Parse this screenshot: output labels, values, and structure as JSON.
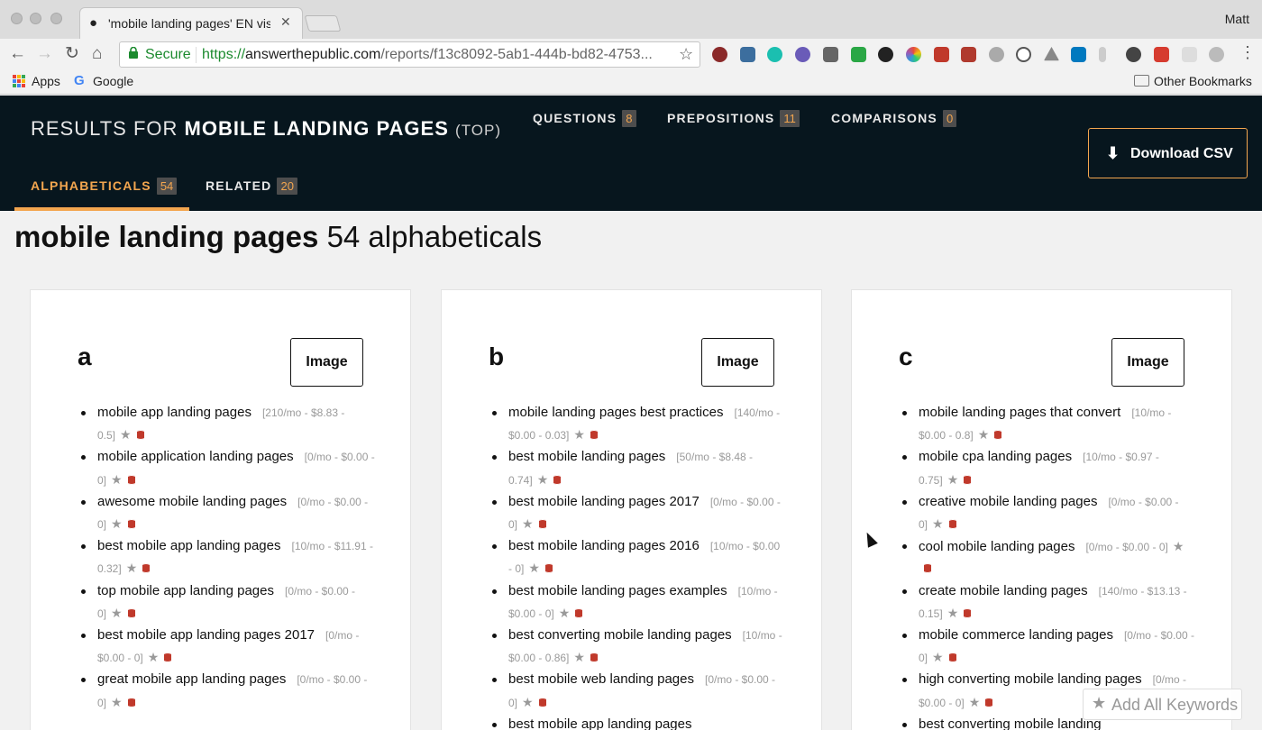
{
  "browser": {
    "tab_title": "'mobile landing pages' EN visu",
    "user_name": "Matt",
    "secure_label": "Secure",
    "url_scheme": "https://",
    "url_host": "answerthepublic.com",
    "url_path": "/reports/f13c8092-5ab1-444b-bd82-4753...",
    "bookmarks": {
      "apps": "Apps",
      "google": "Google",
      "other": "Other Bookmarks"
    }
  },
  "header": {
    "title_prefix": "RESULTS FOR",
    "title_keyword": "MOBILE LANDING PAGES",
    "title_suffix": "(TOP)",
    "tabs": [
      {
        "label": "QUESTIONS",
        "count": "8"
      },
      {
        "label": "PREPOSITIONS",
        "count": "11"
      },
      {
        "label": "COMPARISONS",
        "count": "0"
      },
      {
        "label": "ALPHABETICALS",
        "count": "54"
      },
      {
        "label": "RELATED",
        "count": "20"
      }
    ],
    "download_label": "Download CSV"
  },
  "main": {
    "heading_keyword": "mobile landing pages",
    "heading_rest": "54 alphabeticals",
    "image_button_label": "Image",
    "cards": [
      {
        "letter": "a",
        "items": [
          {
            "text": "mobile app landing pages",
            "meta": "[210/mo - $8.83 - 0.5]"
          },
          {
            "text": "mobile application landing pages",
            "meta": "[0/mo - $0.00 - 0]"
          },
          {
            "text": "awesome mobile landing pages",
            "meta": "[0/mo - $0.00 - 0]"
          },
          {
            "text": "best mobile app landing pages",
            "meta": "[10/mo - $11.91 - 0.32]"
          },
          {
            "text": "top mobile app landing pages",
            "meta": "[0/mo - $0.00 - 0]"
          },
          {
            "text": "best mobile app landing pages 2017",
            "meta": "[0/mo - $0.00 - 0]"
          },
          {
            "text": "great mobile app landing pages",
            "meta": "[0/mo - $0.00 - 0]"
          }
        ]
      },
      {
        "letter": "b",
        "items": [
          {
            "text": "mobile landing pages best practices",
            "meta": "[140/mo - $0.00 - 0.03]"
          },
          {
            "text": "best mobile landing pages",
            "meta": "[50/mo - $8.48 - 0.74]"
          },
          {
            "text": "best mobile landing pages 2017",
            "meta": "[0/mo - $0.00 - 0]"
          },
          {
            "text": "best mobile landing pages 2016",
            "meta": "[10/mo - $0.00 - 0]"
          },
          {
            "text": "best mobile landing pages examples",
            "meta": "[10/mo - $0.00 - 0]"
          },
          {
            "text": "best converting mobile landing pages",
            "meta": "[10/mo - $0.00 - 0.86]"
          },
          {
            "text": "best mobile web landing pages",
            "meta": "[0/mo - $0.00 - 0]"
          },
          {
            "text": "best mobile app landing pages",
            "meta": ""
          }
        ]
      },
      {
        "letter": "c",
        "items": [
          {
            "text": "mobile landing pages that convert",
            "meta": "[10/mo - $0.00 - 0.8]"
          },
          {
            "text": "mobile cpa landing pages",
            "meta": "[10/mo - $0.97 - 0.75]"
          },
          {
            "text": "creative mobile landing pages",
            "meta": "[0/mo - $0.00 - 0]"
          },
          {
            "text": "cool mobile landing pages",
            "meta": "[0/mo - $0.00 - 0]"
          },
          {
            "text": "create mobile landing pages",
            "meta": "[140/mo - $13.13 - 0.15]"
          },
          {
            "text": "mobile commerce landing pages",
            "meta": "[0/mo - $0.00 - 0]"
          },
          {
            "text": "high converting mobile landing pages",
            "meta": "[0/mo - $0.00 - 0]"
          },
          {
            "text": "best converting mobile landing",
            "meta": ""
          }
        ]
      }
    ],
    "add_all_label": "Add All Keywords"
  }
}
